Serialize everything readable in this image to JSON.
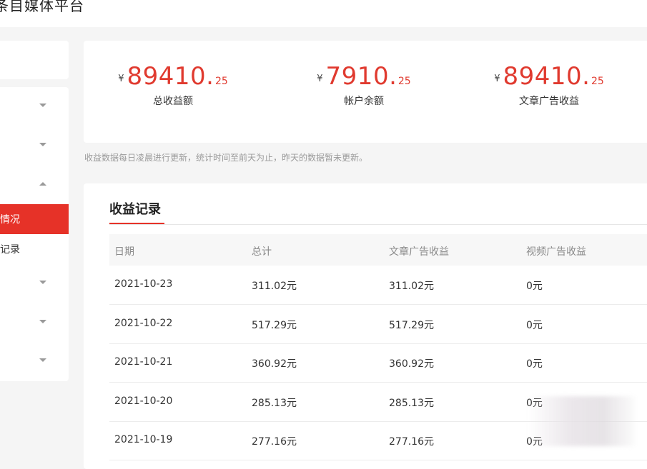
{
  "app": {
    "title": "条目媒体平台"
  },
  "sidebar": {
    "items": [
      {
        "label": "",
        "expanded": false
      },
      {
        "label": "",
        "expanded": false
      },
      {
        "label": "",
        "expanded": true
      },
      {
        "label": "情况",
        "active": true
      },
      {
        "label": "记录",
        "active": false
      },
      {
        "label": "",
        "expanded": false
      },
      {
        "label": "",
        "expanded": false
      },
      {
        "label": "",
        "expanded": false
      }
    ]
  },
  "stats": [
    {
      "currency": "¥",
      "integer": "89410",
      "dot": ".",
      "decimal": "25",
      "label": "总收益额"
    },
    {
      "currency": "¥",
      "integer": "7910",
      "dot": ".",
      "decimal": "25",
      "label": "帐户余额"
    },
    {
      "currency": "¥",
      "integer": "89410",
      "dot": ".",
      "decimal": "25",
      "label": "文章广告收益"
    }
  ],
  "note": "收益数据每日凌晨进行更新，统计时间至前天为止，昨天的数据暂未更新。",
  "records": {
    "title": "收益记录",
    "columns": [
      "日期",
      "总计",
      "文章广告收益",
      "视频广告收益"
    ],
    "rows": [
      [
        "2021-10-23",
        "311.02元",
        "311.02元",
        "0元"
      ],
      [
        "2021-10-22",
        "517.29元",
        "517.29元",
        "0元"
      ],
      [
        "2021-10-21",
        "360.92元",
        "360.92元",
        "0元"
      ],
      [
        "2021-10-20",
        "285.13元",
        "285.13元",
        "0元"
      ],
      [
        "2021-10-19",
        "277.16元",
        "277.16元",
        "0元"
      ]
    ]
  },
  "colors": {
    "accent": "#e63228",
    "amount": "#e03a2f"
  }
}
